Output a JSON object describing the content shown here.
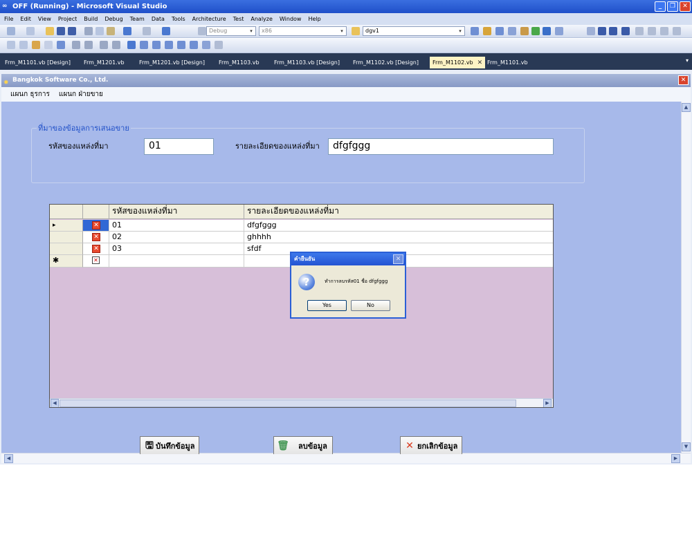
{
  "vs": {
    "title": "OFF (Running) - Microsoft Visual Studio",
    "menu": [
      "File",
      "Edit",
      "View",
      "Project",
      "Build",
      "Debug",
      "Team",
      "Data",
      "Tools",
      "Architecture",
      "Test",
      "Analyze",
      "Window",
      "Help"
    ],
    "toolbar": {
      "config": "Debug",
      "platform": "x86",
      "find": "dgv1"
    },
    "tabs": [
      "Frm_M1101.vb [Design]",
      "Frm_M1201.vb",
      "Frm_M1201.vb [Design]",
      "Frm_M1103.vb",
      "Frm_M1103.vb [Design]",
      "Frm_M1102.vb [Design]",
      "Frm_M1102.vb",
      "Frm_M1101.vb"
    ],
    "active_tab_index": 6
  },
  "form": {
    "title": "Bangkok Software Co., Ltd.",
    "menu": [
      "แผนก ธุรการ",
      "แผนก ฝ่ายขาย"
    ],
    "group_title": "ที่มาของข้อมูลการเสนอขาย",
    "code_label": "รหัสของแหล่งที่มา",
    "code_value": "01",
    "desc_label": "รายละเอียดของแหล่งที่มา",
    "desc_value": "dfgfggg"
  },
  "grid": {
    "columns": [
      "รหัสของแหล่งที่มา",
      "รายละเอียดของแหล่งที่มา"
    ],
    "rows": [
      {
        "code": "01",
        "desc": "dfgfggg"
      },
      {
        "code": "02",
        "desc": "ghhhh"
      },
      {
        "code": "03",
        "desc": "sfdf"
      }
    ]
  },
  "dialog": {
    "title": "คำยืนยัน",
    "message": "ทำการลบรหัส01  ชื่อ dfgfggg",
    "yes": "Yes",
    "no": "No"
  },
  "buttons": {
    "save": "บันทึกข้อมูล",
    "delete": "ลบข้อมูล",
    "cancel": "ยกเลิกข้อมูล"
  }
}
